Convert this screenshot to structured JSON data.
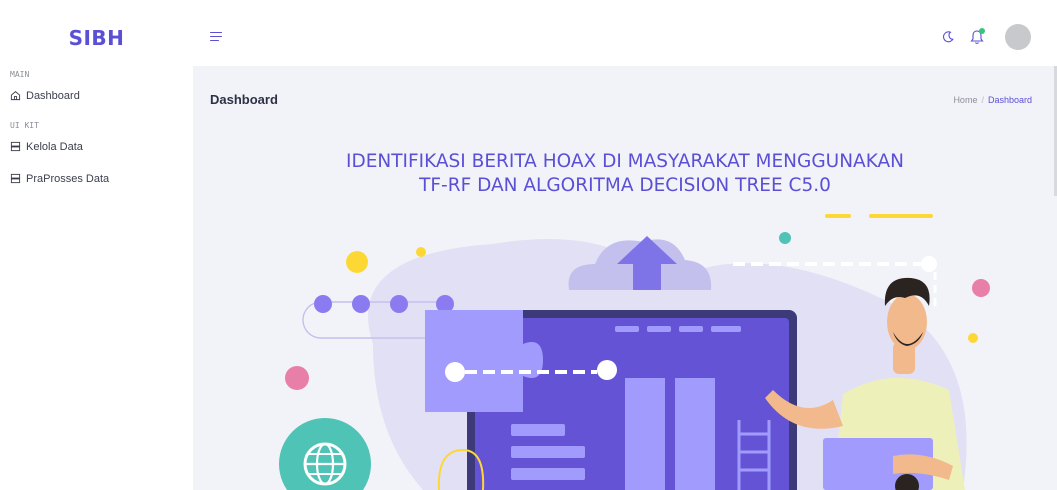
{
  "app": {
    "brand": "SIBH"
  },
  "sidebar": {
    "sections": [
      {
        "label": "MAIN",
        "items": [
          {
            "label": "Dashboard",
            "icon": "home-icon"
          }
        ]
      },
      {
        "label": "UI KIT",
        "items": [
          {
            "label": "Kelola Data",
            "icon": "server-icon"
          },
          {
            "label": "PraProsses Data",
            "icon": "server-icon"
          }
        ]
      }
    ]
  },
  "topbar": {
    "menu_icon": "hamburger-icon",
    "icons": [
      "moon-icon",
      "bell-icon",
      "avatar"
    ],
    "notification_dot_color": "#37c57e"
  },
  "page": {
    "title": "Dashboard",
    "breadcrumb": [
      "Home",
      "Dashboard"
    ]
  },
  "hero": {
    "title_line1": "IDENTIFIKASI BERITA HOAX DI MASYARAKAT MENGGUNAKAN",
    "title_line2": "TF-RF DAN ALGORITMA DECISION TREE C5.0"
  },
  "colors": {
    "accent": "#5b4fd6",
    "background": "#f2f3f8",
    "illustration_purple": "#6c5ce7",
    "illustration_light_purple": "#a29bfe",
    "yellow": "#fdd835",
    "teal": "#4fc3b6",
    "pink": "#e87fa8"
  }
}
